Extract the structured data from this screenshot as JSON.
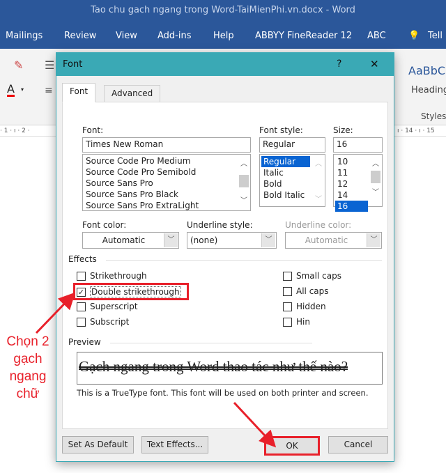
{
  "window": {
    "title": "Tao chu gach ngang trong Word-TaiMienPhi.vn.docx  -  Word"
  },
  "menu": [
    "Mailings",
    "Review",
    "View",
    "Add-ins",
    "Help",
    "ABBYY FineReader 12",
    "ABC",
    "Tell"
  ],
  "ribbon": {
    "style_preview": "AaBbC",
    "style_name": "Heading",
    "group_label": "Styles"
  },
  "ruler": {
    "left": "· 1 · ı · 2 ·",
    "right": "ı · 14 · ı · 15"
  },
  "dialog": {
    "title": "Font",
    "help": "?",
    "close": "✕",
    "tabs": [
      "Font",
      "Advanced"
    ],
    "font_label": "Font:",
    "font_value": "Times New Roman",
    "font_list": [
      "Source Code Pro Medium",
      "Source Code Pro Semibold",
      "Source Sans Pro",
      "Source Sans Pro Black",
      "Source Sans Pro ExtraLight"
    ],
    "style_label": "Font style:",
    "style_value": "Regular",
    "style_list": [
      "Regular",
      "Italic",
      "Bold",
      "Bold Italic"
    ],
    "style_selected": "Regular",
    "size_label": "Size:",
    "size_value": "16",
    "size_list": [
      "10",
      "11",
      "12",
      "14",
      "16"
    ],
    "size_selected": "16",
    "font_color_label": "Font color:",
    "font_color_value": "Automatic",
    "underline_style_label": "Underline style:",
    "underline_style_value": "(none)",
    "underline_color_label": "Underline color:",
    "underline_color_value": "Automatic",
    "effects_label": "Effects",
    "effects_left": [
      {
        "label": "Strikethrough",
        "checked": false
      },
      {
        "label": "Double strikethrough",
        "checked": true
      },
      {
        "label": "Superscript",
        "checked": false
      },
      {
        "label": "Subscript",
        "checked": false
      }
    ],
    "effects_right": [
      {
        "label": "Small caps",
        "checked": false
      },
      {
        "label": "All caps",
        "checked": false
      },
      {
        "label": "Hidden",
        "checked": false
      },
      {
        "label": "Hin",
        "checked": false
      }
    ],
    "preview_label": "Preview",
    "preview_text": "Gạch ngang trong Word thao tác như thế nào?",
    "truetype_note": "This is a TrueType font. This font will be used on both printer and screen.",
    "buttons": {
      "set_default": "Set As Default",
      "text_effects": "Text Effects...",
      "ok": "OK",
      "cancel": "Cancel"
    }
  },
  "annotation": {
    "text": [
      "Chọn 2",
      "gạch",
      "ngang",
      "chữ"
    ],
    "color": "#e8202a"
  },
  "colors": {
    "title_bar": "#2b579a",
    "dialog_title": "#3aa9b5",
    "highlight": "#e8202a",
    "selection": "#0a64d2"
  }
}
